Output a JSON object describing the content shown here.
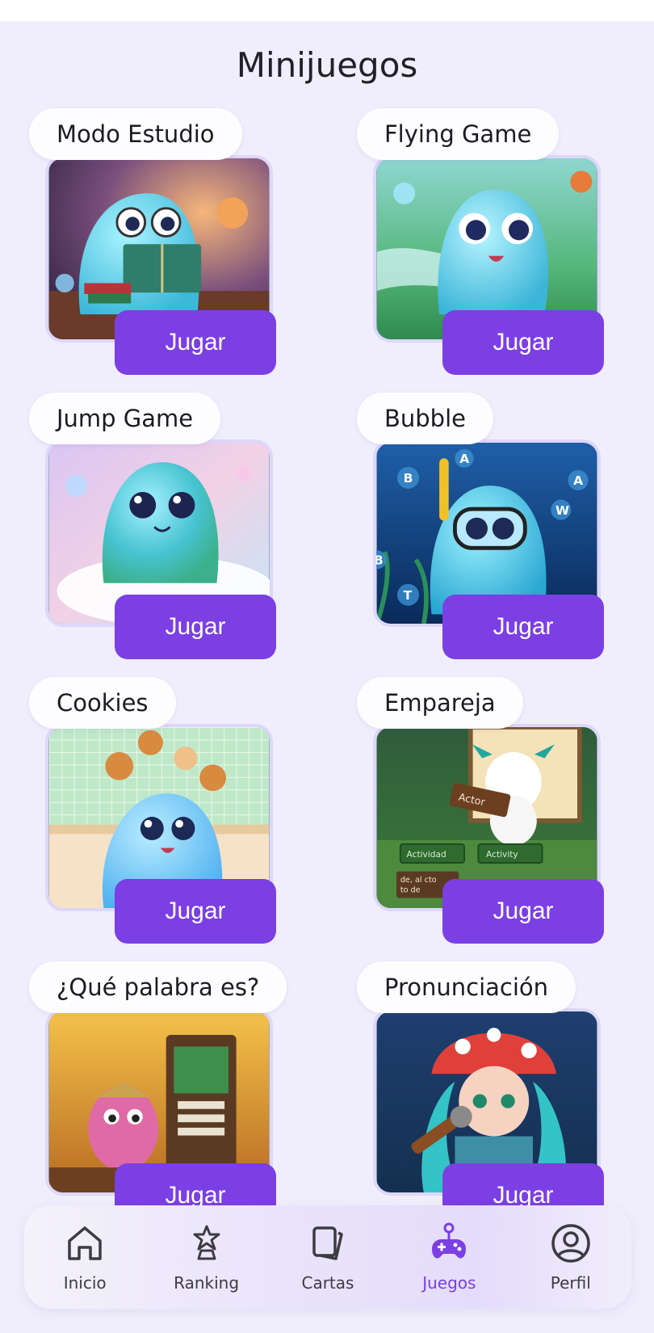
{
  "page": {
    "title": "Minijuegos"
  },
  "games": [
    {
      "label": "Modo Estudio",
      "button": "Jugar",
      "theme": "study"
    },
    {
      "label": "Flying Game",
      "button": "Jugar",
      "theme": "flying"
    },
    {
      "label": "Jump Game",
      "button": "Jugar",
      "theme": "jump"
    },
    {
      "label": "Bubble",
      "button": "Jugar",
      "theme": "bubble"
    },
    {
      "label": "Cookies",
      "button": "Jugar",
      "theme": "cookies"
    },
    {
      "label": "Empareja",
      "button": "Jugar",
      "theme": "match"
    },
    {
      "label": "¿Qué palabra es?",
      "button": "Jugar",
      "theme": "word"
    },
    {
      "label": "Pronunciación",
      "button": "Jugar",
      "theme": "pronounce"
    }
  ],
  "thumbnail_text": {
    "bubble_letters": [
      "B",
      "A",
      "A",
      "W",
      "B",
      "T"
    ],
    "match_words": [
      "Actor",
      "Actividad",
      "Activity",
      "de, al cto",
      "to de"
    ]
  },
  "nav": {
    "items": [
      {
        "label": "Inicio",
        "icon": "home-icon"
      },
      {
        "label": "Ranking",
        "icon": "trophy-icon"
      },
      {
        "label": "Cartas",
        "icon": "cards-icon"
      },
      {
        "label": "Juegos",
        "icon": "gamepad-icon"
      },
      {
        "label": "Perfil",
        "icon": "profile-icon"
      }
    ],
    "active": "Juegos"
  },
  "colors": {
    "accent": "#7b3fe4",
    "background": "#f0eefc",
    "pill": "#fdfdff"
  }
}
